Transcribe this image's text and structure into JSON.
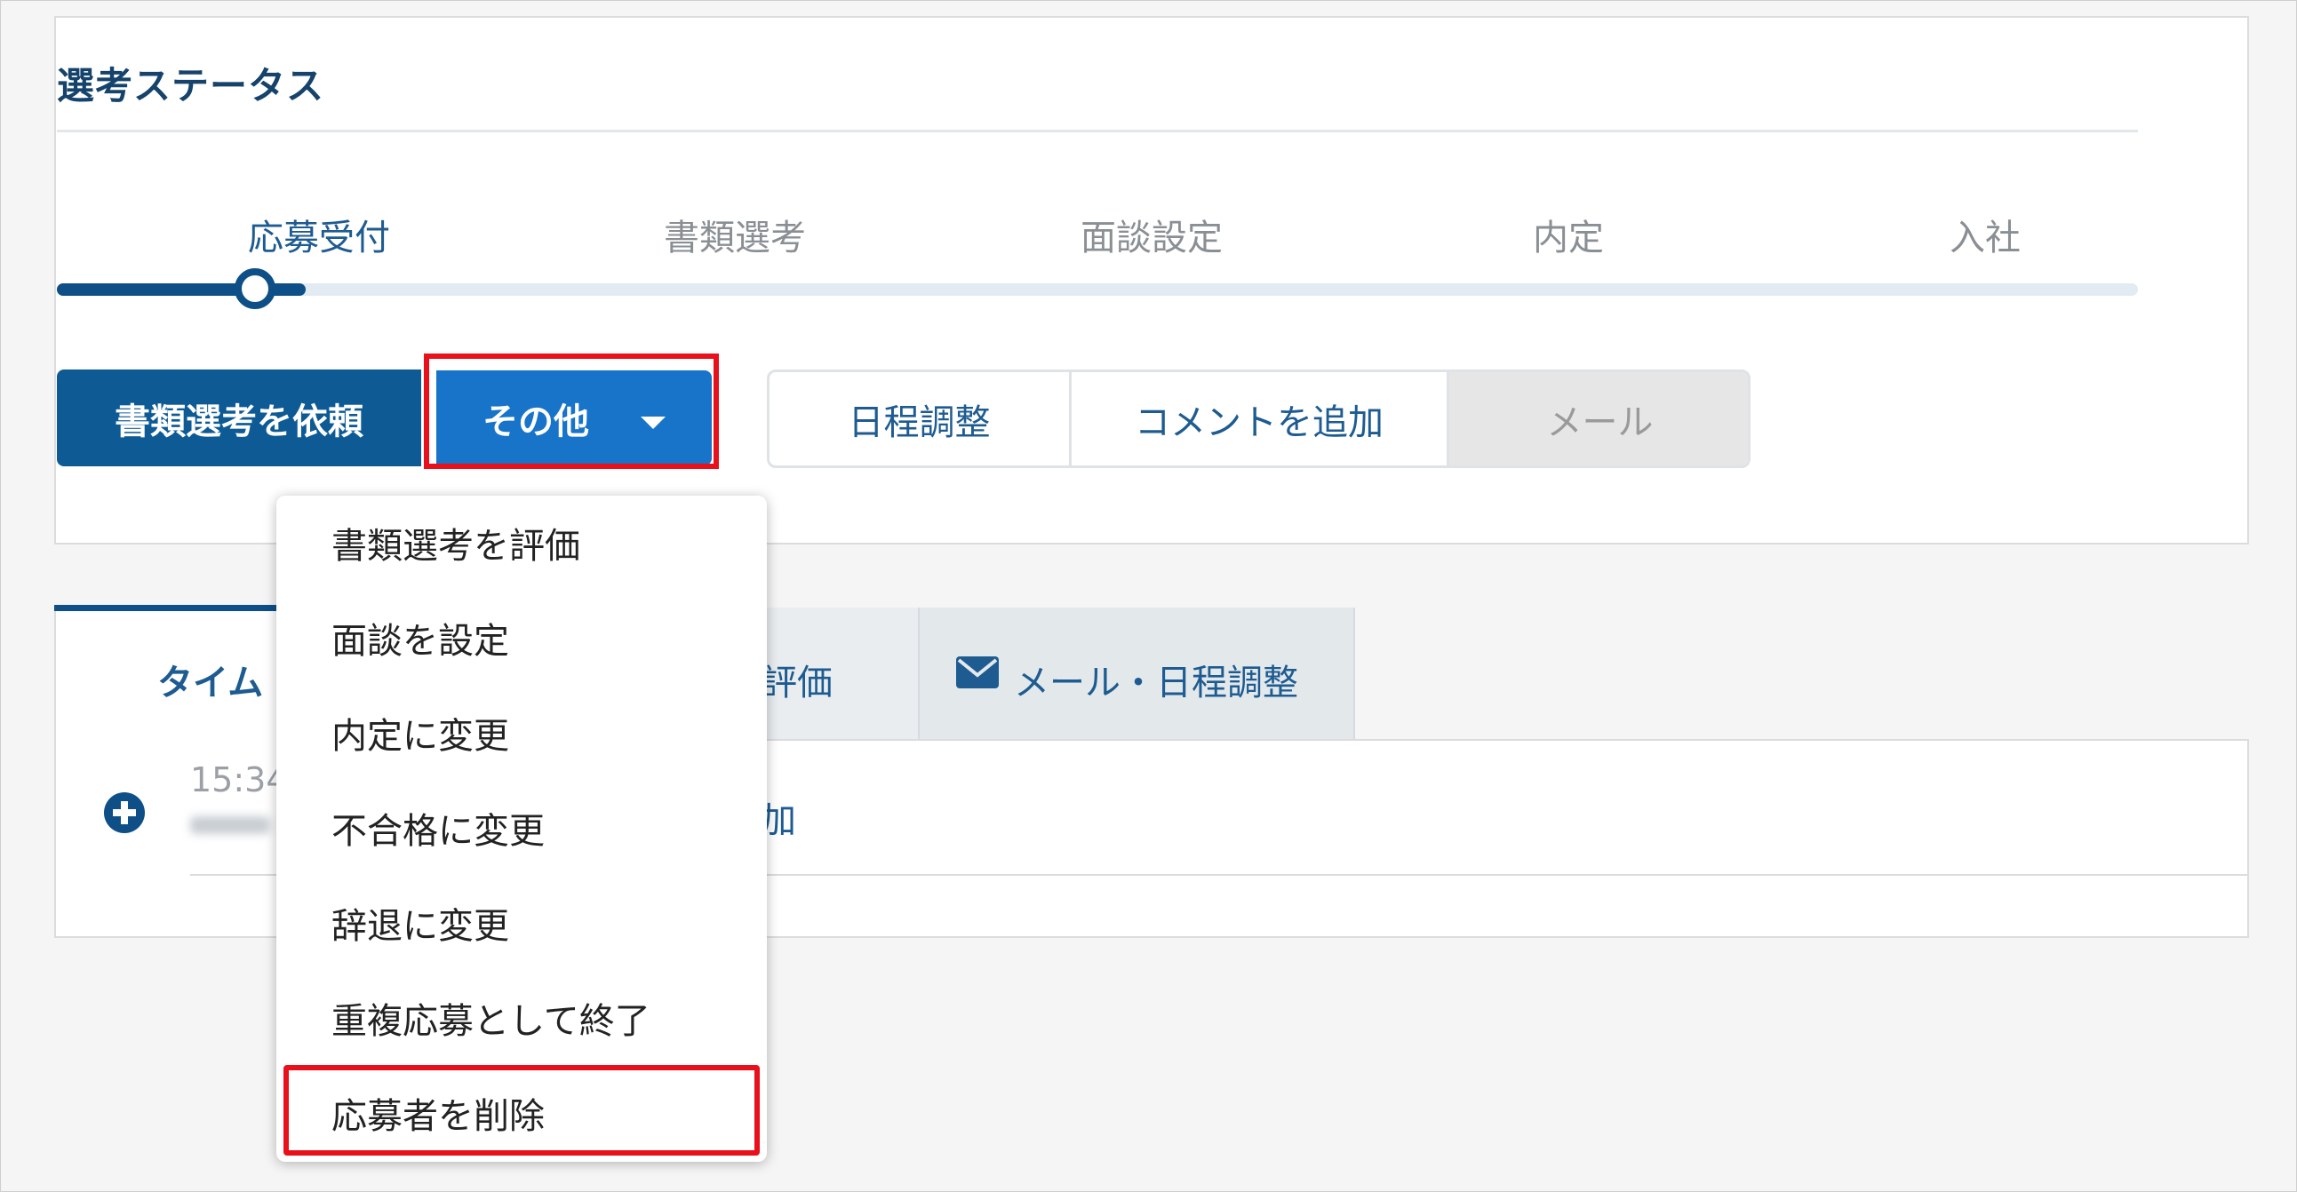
{
  "status": {
    "title": "選考ステータス",
    "steps": [
      "応募受付",
      "書類選考",
      "面談設定",
      "内定",
      "入社"
    ],
    "current_step": 0
  },
  "actions": {
    "primary_label": "書類選考を依頼",
    "other_label": "その他",
    "schedule_label": "日程調整",
    "comment_label": "コメントを追加",
    "mail_label": "メール"
  },
  "tabs": {
    "timeline_label": "タイム",
    "evaluation_label": "評価",
    "mail_schedule_label": "メール・日程調整"
  },
  "timeline": {
    "entry_time": "15:34",
    "entry_text": "加"
  },
  "menu": {
    "items": [
      "書類選考を評価",
      "面談を設定",
      "内定に変更",
      "不合格に変更",
      "辞退に変更",
      "重複応募として終了",
      "応募者を削除"
    ]
  },
  "colors": {
    "primary": "#0d5a95",
    "other_button": "#1774c9",
    "highlight": "#e8101a"
  }
}
